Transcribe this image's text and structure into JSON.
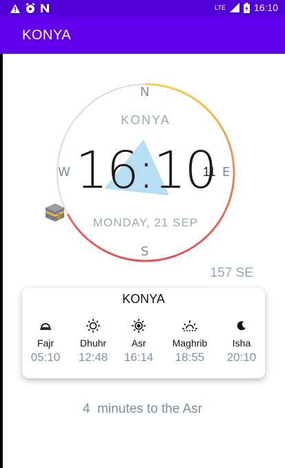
{
  "status_bar": {
    "time": "16:10",
    "network": "LTE",
    "left_icons": [
      "warning-icon",
      "alarm-icon",
      "n-icon"
    ]
  },
  "app_bar": {
    "title": "KONYA"
  },
  "compass": {
    "north": "N",
    "east": "E",
    "south": "S",
    "west": "W",
    "city": "KONYA",
    "time": "16:10",
    "date": "MONDAY, 21 SEP",
    "degree": "11",
    "arc_colors": [
      "#f3cf4f",
      "#e9885b",
      "#de5459"
    ]
  },
  "bearing": "157 SE",
  "card": {
    "title": "KONYA",
    "prayers": [
      {
        "name": "Fajr",
        "time": "05:10",
        "icon": "sunrise-horizon-icon"
      },
      {
        "name": "Dhuhr",
        "time": "12:48",
        "icon": "sun-icon"
      },
      {
        "name": "Asr",
        "time": "16:14",
        "icon": "sun-bold-icon"
      },
      {
        "name": "Maghrib",
        "time": "18:55",
        "icon": "sunset-icon"
      },
      {
        "name": "Isha",
        "time": "20:10",
        "icon": "moon-icon"
      }
    ]
  },
  "remaining": "4  minutes to the Asr"
}
